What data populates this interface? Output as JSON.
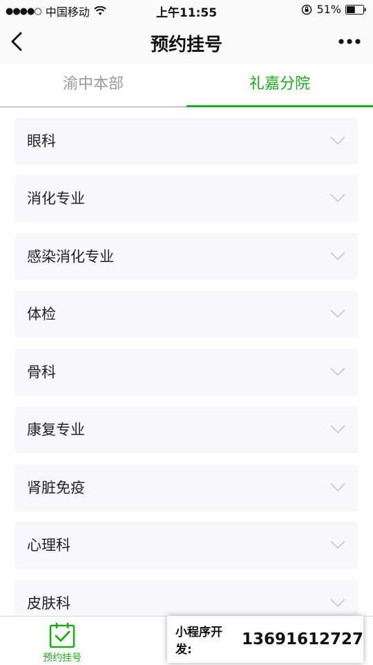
{
  "status_bar": {
    "signal": "●●●●○",
    "carrier": "中国移动",
    "time": "上午11:55",
    "battery": "51%",
    "battery_level": 0.51
  },
  "nav": {
    "title": "预约挂号"
  },
  "tabs": [
    {
      "label": "渝中本部",
      "active": false
    },
    {
      "label": "礼嘉分院",
      "active": true
    }
  ],
  "departments": [
    {
      "label": "眼科"
    },
    {
      "label": "消化专业"
    },
    {
      "label": "感染消化专业"
    },
    {
      "label": "体检"
    },
    {
      "label": "骨科"
    },
    {
      "label": "康复专业"
    },
    {
      "label": "肾脏免疫"
    },
    {
      "label": "心理科"
    },
    {
      "label": "皮肤科"
    }
  ],
  "tabbar": {
    "items": [
      {
        "label": "预约挂号",
        "icon": "calendar-check-icon",
        "active": true
      }
    ]
  },
  "promo": {
    "label": "小程序开发:",
    "phone": "13691612727"
  },
  "colors": {
    "accent": "#1aad19",
    "inactive_tab": "#9a9a9a",
    "item_bg": "#f8f8fa"
  }
}
